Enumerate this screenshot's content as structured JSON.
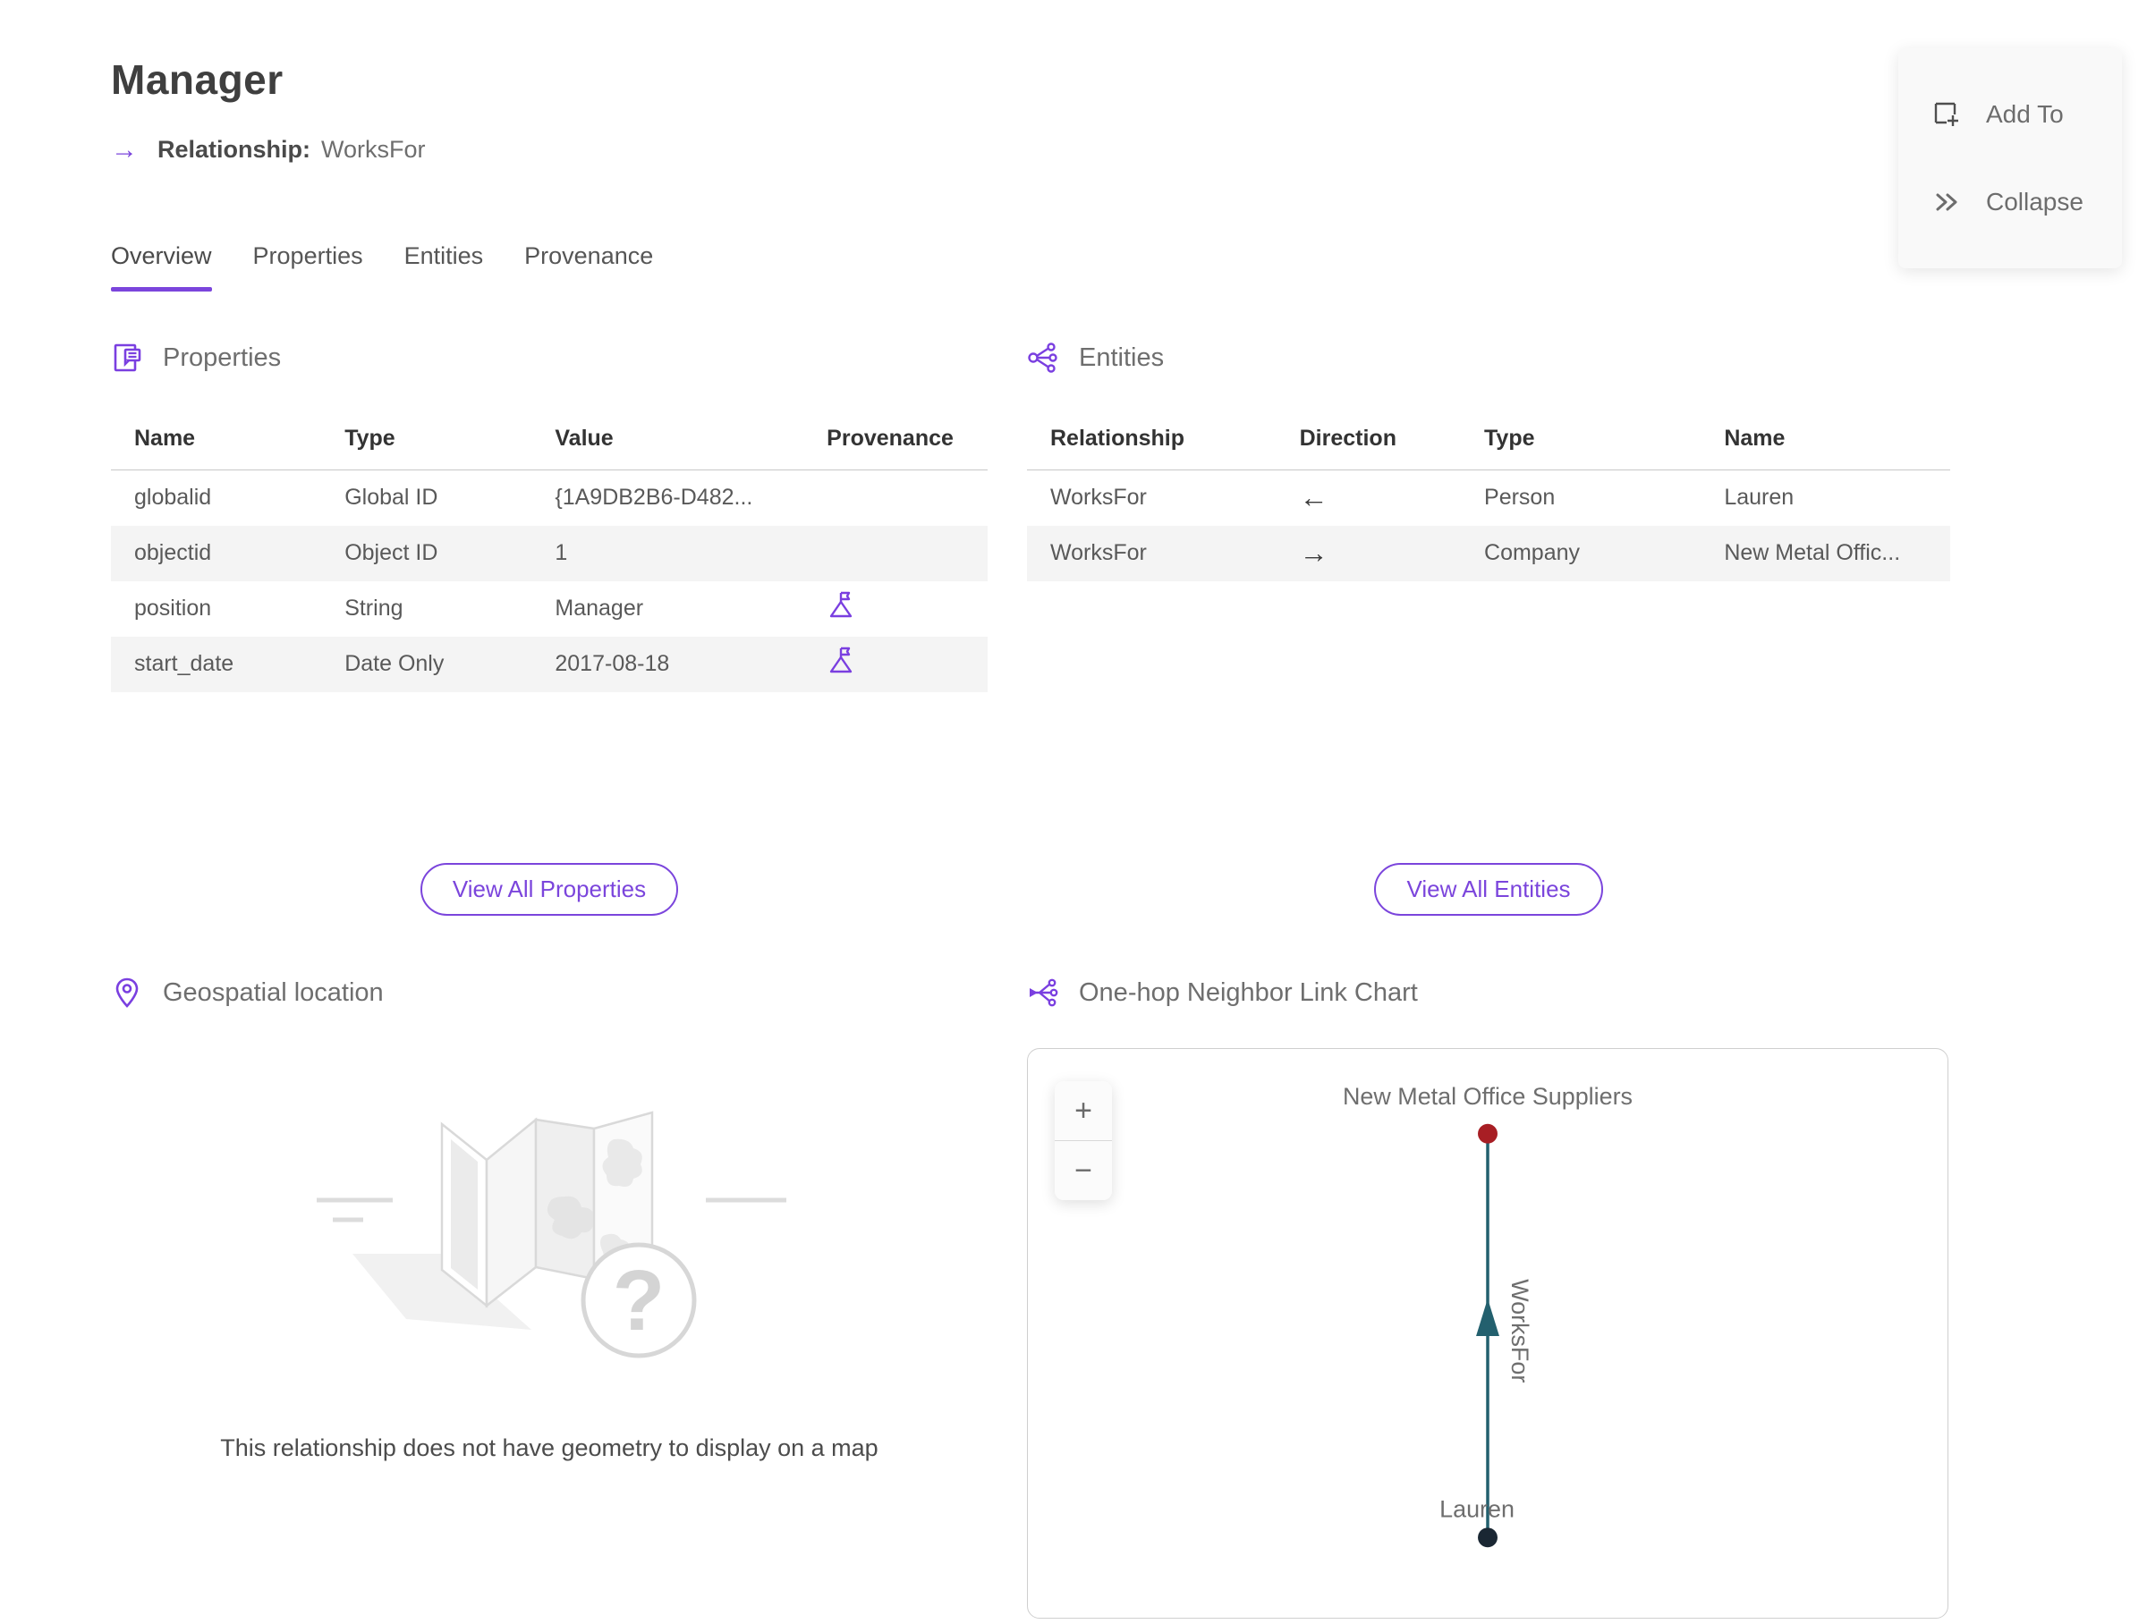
{
  "page": {
    "title": "Manager",
    "subtitle_arrow": "→",
    "subtitle_label": "Relationship:",
    "subtitle_value": "WorksFor"
  },
  "actions": {
    "add_to": "Add To",
    "collapse": "Collapse"
  },
  "tabs": [
    {
      "label": "Overview",
      "active": true
    },
    {
      "label": "Properties",
      "active": false
    },
    {
      "label": "Entities",
      "active": false
    },
    {
      "label": "Provenance",
      "active": false
    }
  ],
  "properties_section": {
    "title": "Properties",
    "columns": [
      "Name",
      "Type",
      "Value",
      "Provenance"
    ],
    "rows": [
      {
        "name": "globalid",
        "type": "Global ID",
        "value": "{1A9DB2B6-D482...",
        "has_provenance": false
      },
      {
        "name": "objectid",
        "type": "Object ID",
        "value": "1",
        "has_provenance": false
      },
      {
        "name": "position",
        "type": "String",
        "value": "Manager",
        "has_provenance": true
      },
      {
        "name": "start_date",
        "type": "Date Only",
        "value": "2017-08-18",
        "has_provenance": true
      }
    ],
    "view_all": "View All Properties"
  },
  "entities_section": {
    "title": "Entities",
    "columns": [
      "Relationship",
      "Direction",
      "Type",
      "Name"
    ],
    "rows": [
      {
        "relationship": "WorksFor",
        "direction": "←",
        "type": "Person",
        "name": "Lauren"
      },
      {
        "relationship": "WorksFor",
        "direction": "→",
        "type": "Company",
        "name": "New Metal Offic..."
      }
    ],
    "view_all": "View All Entities"
  },
  "geospatial_section": {
    "title": "Geospatial location",
    "empty_message": "This relationship does not have geometry to display on a map"
  },
  "link_chart_section": {
    "title": "One-hop Neighbor Link Chart",
    "zoom_in": "+",
    "zoom_out": "−",
    "chart": {
      "type": "node-link",
      "nodes": [
        {
          "label": "New Metal Office Suppliers",
          "color": "#a81e24",
          "position": "top"
        },
        {
          "label": "Lauren",
          "color": "#1a2733",
          "position": "bottom"
        }
      ],
      "edge": {
        "label": "WorksFor",
        "from": "Lauren",
        "to": "New Metal Office Suppliers",
        "direction": "up",
        "color": "#23606e"
      }
    }
  },
  "colors": {
    "accent_purple": "#7b45dc",
    "link_purple": "#8160df",
    "edge_teal": "#23606e",
    "node_red": "#a81e24",
    "node_dark": "#1a2733",
    "alt_row": "#f4f4f4"
  }
}
